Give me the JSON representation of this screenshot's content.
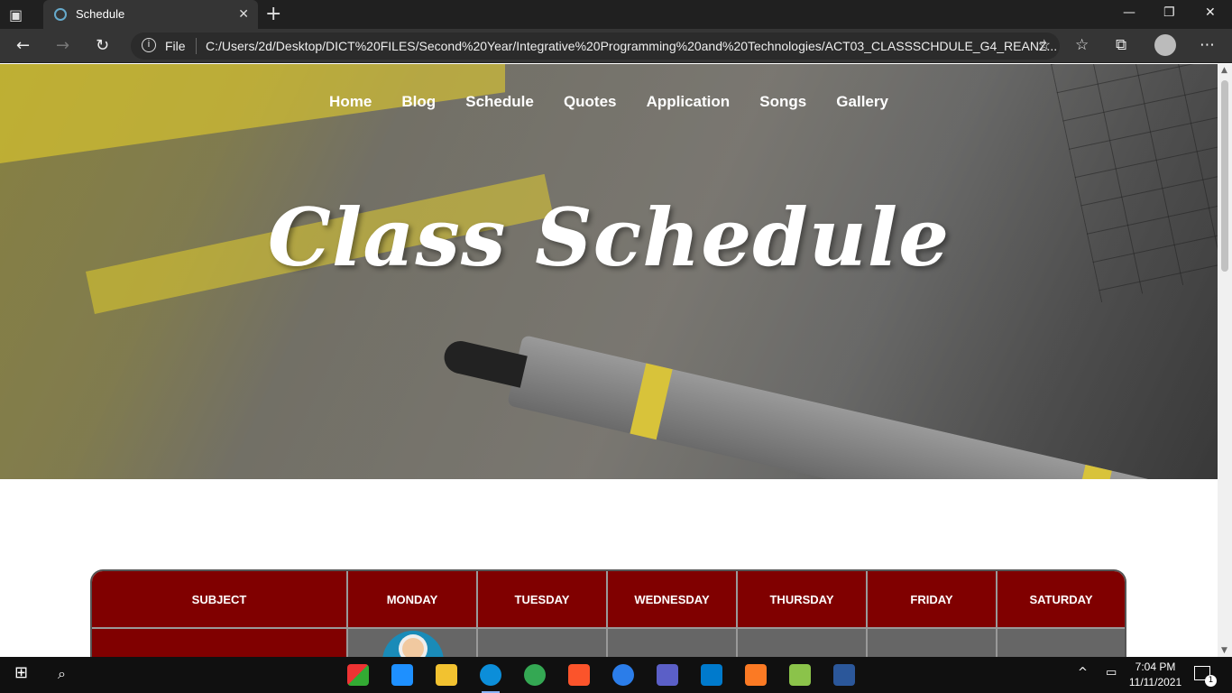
{
  "browser": {
    "tab_title": "Schedule",
    "address_label": "File",
    "url": "C:/Users/2d/Desktop/DICT%20FILES/Second%20Year/Integrative%20Programming%20and%20Technologies/ACT03_CLASSSCHDULE_G4_REANZ..."
  },
  "nav": {
    "items": [
      {
        "label": "Home"
      },
      {
        "label": "Blog"
      },
      {
        "label": "Schedule"
      },
      {
        "label": "Quotes"
      },
      {
        "label": "Application"
      },
      {
        "label": "Songs"
      },
      {
        "label": "Gallery"
      }
    ]
  },
  "hero": {
    "title": "Class Schedule"
  },
  "schedule": {
    "headers": [
      "SUBJECT",
      "MONDAY",
      "TUESDAY",
      "WEDNESDAY",
      "THURSDAY",
      "FRIDAY",
      "SATURDAY"
    ]
  },
  "taskbar": {
    "time": "7:04 PM",
    "date": "11/11/2021",
    "notifications": "1",
    "colors": {
      "accent": "#800000",
      "tab_active": "#353535"
    }
  }
}
